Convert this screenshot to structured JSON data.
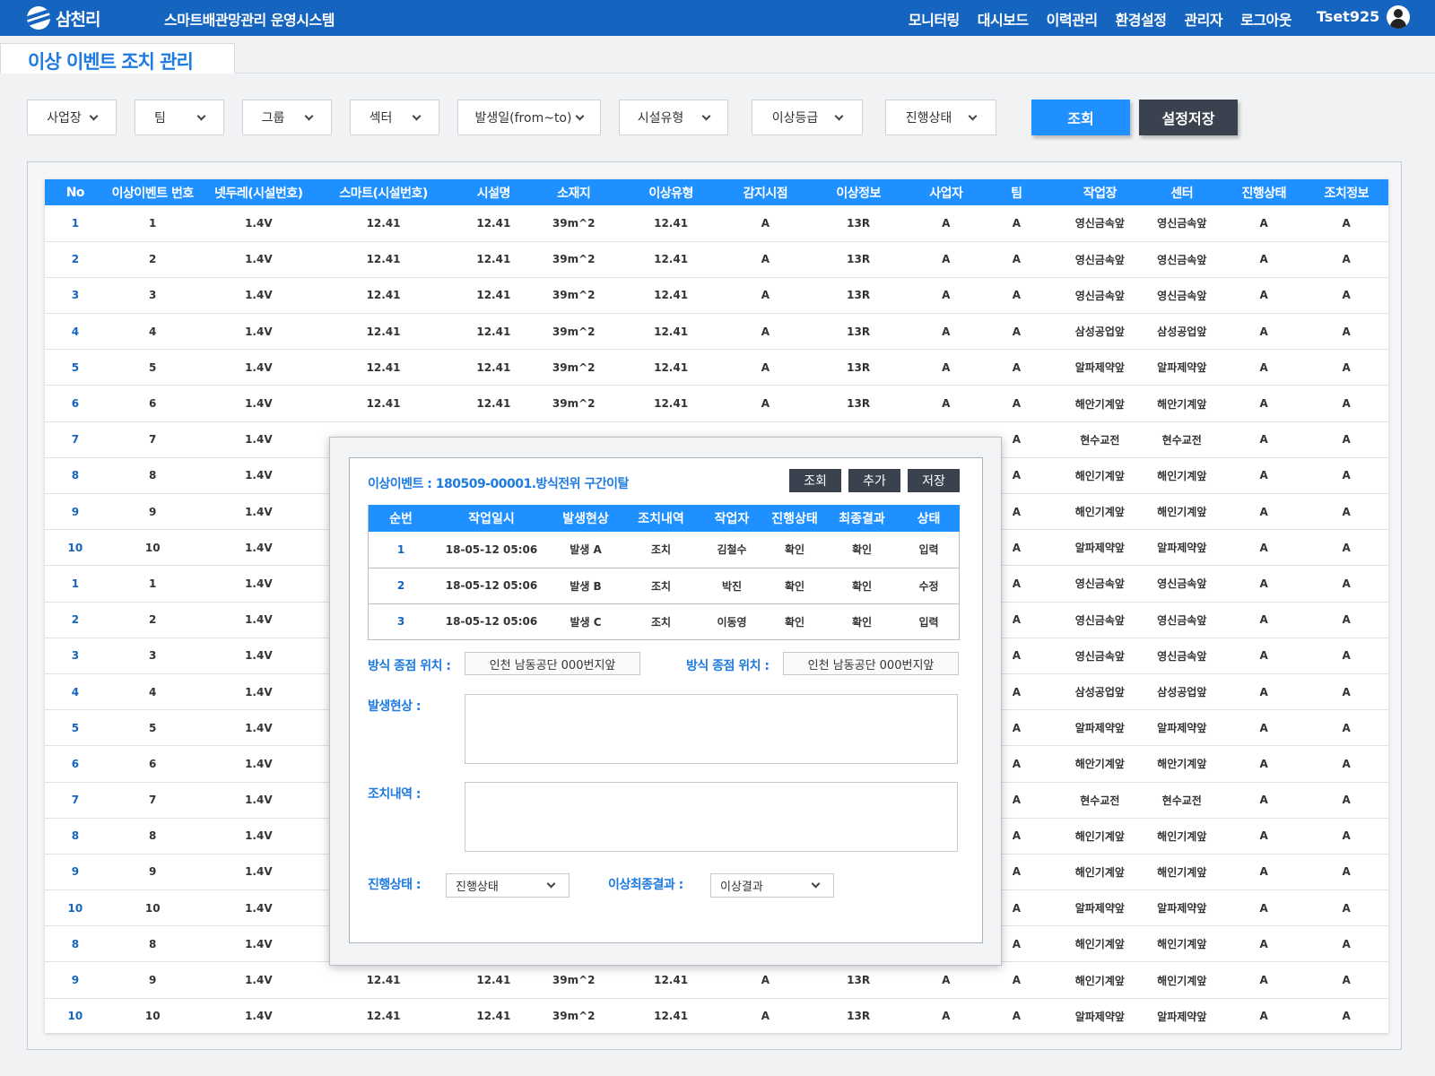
{
  "header": {
    "logo_text": "삼천리",
    "system_title": "스마트배관망관리 운영시스템",
    "nav": [
      "모니터링",
      "대시보드",
      "이력관리",
      "환경설정",
      "관리자",
      "로그아웃"
    ],
    "user_name": "Tset925"
  },
  "page": {
    "title": "이상 이벤트 조치 관리"
  },
  "filters": [
    "사업장",
    "팀",
    "그룹",
    "섹터",
    "발생일(from~to)",
    "시설유형",
    "이상등급",
    "진행상태"
  ],
  "buttons": {
    "search": "조회",
    "save_settings": "설정저장"
  },
  "table": {
    "columns": [
      "No",
      "이상이벤트 번호",
      "넷두레(시설번호)",
      "스마트(시설번호)",
      "시설명",
      "소재지",
      "이상유형",
      "감지시점",
      "이상정보",
      "사업자",
      "팀",
      "작업장",
      "센터",
      "진행상태",
      "조치정보"
    ],
    "rows": [
      [
        "1",
        "1",
        "1.4V",
        "12.41",
        "12.41",
        "39m^2",
        "12.41",
        "A",
        "13R",
        "A",
        "A",
        "영신금속앞",
        "영신금속앞",
        "A",
        "A"
      ],
      [
        "2",
        "2",
        "1.4V",
        "12.41",
        "12.41",
        "39m^2",
        "12.41",
        "A",
        "13R",
        "A",
        "A",
        "영신금속앞",
        "영신금속앞",
        "A",
        "A"
      ],
      [
        "3",
        "3",
        "1.4V",
        "12.41",
        "12.41",
        "39m^2",
        "12.41",
        "A",
        "13R",
        "A",
        "A",
        "영신금속앞",
        "영신금속앞",
        "A",
        "A"
      ],
      [
        "4",
        "4",
        "1.4V",
        "12.41",
        "12.41",
        "39m^2",
        "12.41",
        "A",
        "13R",
        "A",
        "A",
        "삼성공업앞",
        "삼성공업앞",
        "A",
        "A"
      ],
      [
        "5",
        "5",
        "1.4V",
        "12.41",
        "12.41",
        "39m^2",
        "12.41",
        "A",
        "13R",
        "A",
        "A",
        "알파제약앞",
        "알파제약앞",
        "A",
        "A"
      ],
      [
        "6",
        "6",
        "1.4V",
        "12.41",
        "12.41",
        "39m^2",
        "12.41",
        "A",
        "13R",
        "A",
        "A",
        "해안기계앞",
        "해안기계앞",
        "A",
        "A"
      ],
      [
        "7",
        "7",
        "1.4V",
        "",
        "",
        "",
        "",
        "",
        "",
        "",
        "A",
        "현수교전",
        "현수교전",
        "A",
        "A"
      ],
      [
        "8",
        "8",
        "1.4V",
        "",
        "",
        "",
        "",
        "",
        "",
        "",
        "A",
        "해인기계앞",
        "해인기계앞",
        "A",
        "A"
      ],
      [
        "9",
        "9",
        "1.4V",
        "",
        "",
        "",
        "",
        "",
        "",
        "",
        "A",
        "해인기계앞",
        "해인기계앞",
        "A",
        "A"
      ],
      [
        "10",
        "10",
        "1.4V",
        "",
        "",
        "",
        "",
        "",
        "",
        "",
        "A",
        "알파제약앞",
        "알파제약앞",
        "A",
        "A"
      ],
      [
        "1",
        "1",
        "1.4V",
        "",
        "",
        "",
        "",
        "",
        "",
        "",
        "A",
        "영신금속앞",
        "영신금속앞",
        "A",
        "A"
      ],
      [
        "2",
        "2",
        "1.4V",
        "",
        "",
        "",
        "",
        "",
        "",
        "",
        "A",
        "영신금속앞",
        "영신금속앞",
        "A",
        "A"
      ],
      [
        "3",
        "3",
        "1.4V",
        "",
        "",
        "",
        "",
        "",
        "",
        "",
        "A",
        "영신금속앞",
        "영신금속앞",
        "A",
        "A"
      ],
      [
        "4",
        "4",
        "1.4V",
        "",
        "",
        "",
        "",
        "",
        "",
        "",
        "A",
        "삼성공업앞",
        "삼성공업앞",
        "A",
        "A"
      ],
      [
        "5",
        "5",
        "1.4V",
        "",
        "",
        "",
        "",
        "",
        "",
        "",
        "A",
        "알파제약앞",
        "알파제약앞",
        "A",
        "A"
      ],
      [
        "6",
        "6",
        "1.4V",
        "",
        "",
        "",
        "",
        "",
        "",
        "",
        "A",
        "해안기계앞",
        "해안기계앞",
        "A",
        "A"
      ],
      [
        "7",
        "7",
        "1.4V",
        "",
        "",
        "",
        "",
        "",
        "",
        "",
        "A",
        "현수교전",
        "현수교전",
        "A",
        "A"
      ],
      [
        "8",
        "8",
        "1.4V",
        "",
        "",
        "",
        "",
        "",
        "",
        "",
        "A",
        "해인기계앞",
        "해인기계앞",
        "A",
        "A"
      ],
      [
        "9",
        "9",
        "1.4V",
        "",
        "",
        "",
        "",
        "",
        "",
        "",
        "A",
        "해인기계앞",
        "해인기계앞",
        "A",
        "A"
      ],
      [
        "10",
        "10",
        "1.4V",
        "",
        "",
        "",
        "",
        "",
        "",
        "",
        "A",
        "알파제약앞",
        "알파제약앞",
        "A",
        "A"
      ],
      [
        "8",
        "8",
        "1.4V",
        "",
        "",
        "",
        "",
        "",
        "",
        "",
        "A",
        "해인기계앞",
        "해인기계앞",
        "A",
        "A"
      ],
      [
        "9",
        "9",
        "1.4V",
        "12.41",
        "12.41",
        "39m^2",
        "12.41",
        "A",
        "13R",
        "A",
        "A",
        "해인기계앞",
        "해인기계앞",
        "A",
        "A"
      ],
      [
        "10",
        "10",
        "1.4V",
        "12.41",
        "12.41",
        "39m^2",
        "12.41",
        "A",
        "13R",
        "A",
        "A",
        "알파제약앞",
        "알파제약앞",
        "A",
        "A"
      ]
    ]
  },
  "modal": {
    "title": "이상이벤트 : 180509-00001.방식전위 구간이탈",
    "buttons": [
      "조회",
      "추가",
      "저장"
    ],
    "columns": [
      "순번",
      "작업일시",
      "발생현상",
      "조치내역",
      "작업자",
      "진행상태",
      "최종결과",
      "상태"
    ],
    "rows": [
      [
        "1",
        "18-05-12 05:06",
        "발생 A",
        "조치",
        "김철수",
        "확인",
        "확인",
        "입력"
      ],
      [
        "2",
        "18-05-12 05:06",
        "발생 B",
        "조치",
        "박진",
        "확인",
        "확인",
        "수정"
      ],
      [
        "3",
        "18-05-12 05:06",
        "발생 C",
        "조치",
        "이동영",
        "확인",
        "확인",
        "입력"
      ]
    ],
    "location_label_1": "방식 종점 위치 :",
    "location_value_1": "인천 남동공단 000번지앞",
    "location_label_2": "방식 종점 위치 :",
    "location_value_2": "인천 남동공단 000번지앞",
    "phenomenon_label": "발생현상 :",
    "action_label": "조치내역 :",
    "status_label": "진행상태 :",
    "status_value": "진행상태",
    "final_result_label": "이상최종결과 :",
    "final_result_value": "이상결과"
  }
}
